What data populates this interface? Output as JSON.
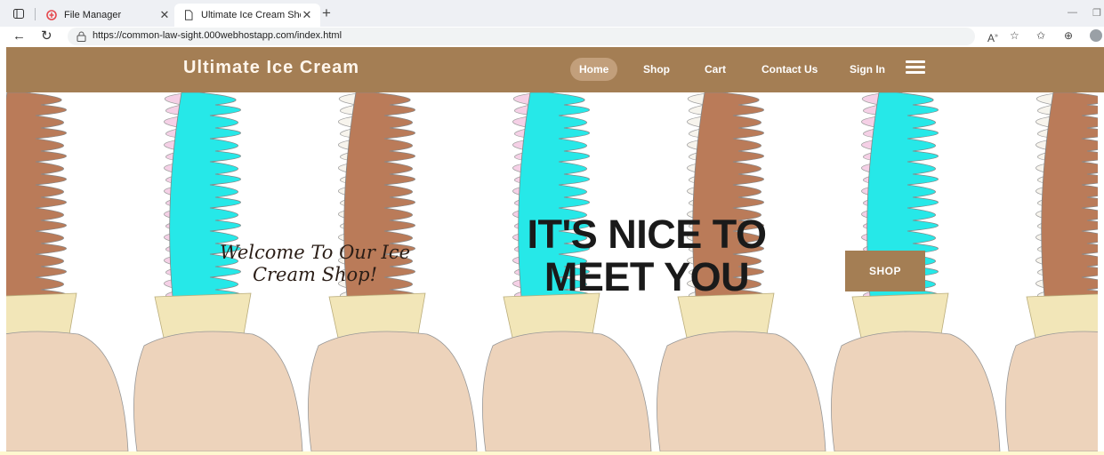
{
  "browser": {
    "tabs": [
      {
        "title": "File Manager",
        "active": false
      },
      {
        "title": "Ultimate Ice Cream Shop",
        "active": true
      }
    ],
    "url": "https://common-law-sight.000webhostapp.com/index.html"
  },
  "site": {
    "brand": "Ultimate Ice Cream",
    "nav": [
      {
        "label": "Home",
        "active": true
      },
      {
        "label": "Shop",
        "active": false
      },
      {
        "label": "Cart",
        "active": false
      },
      {
        "label": "Contact Us",
        "active": false
      },
      {
        "label": "Sign In",
        "active": false
      }
    ],
    "hero": {
      "welcome_line1": "Welcome To Our Ice",
      "welcome_line2": "Cream Shop!",
      "headline_line1": "IT'S NICE TO",
      "headline_line2": "MEET YOU",
      "cta": "SHOP"
    }
  },
  "colors": {
    "nav_bg": "#a47e54",
    "active_pill": "#c29f7b",
    "chocolate": "#b5704b",
    "cyan": "#14e6e6",
    "pink": "#f5cde4",
    "vanilla": "#f7f3ec",
    "cone": "#f1e4b2",
    "hand": "#ecd0b6"
  },
  "icons": {
    "sidebar": "sidebar-toggle-icon",
    "back": "back-arrow-icon",
    "refresh": "refresh-icon",
    "info": "site-info-icon",
    "menu": "hamburger-menu-icon"
  }
}
